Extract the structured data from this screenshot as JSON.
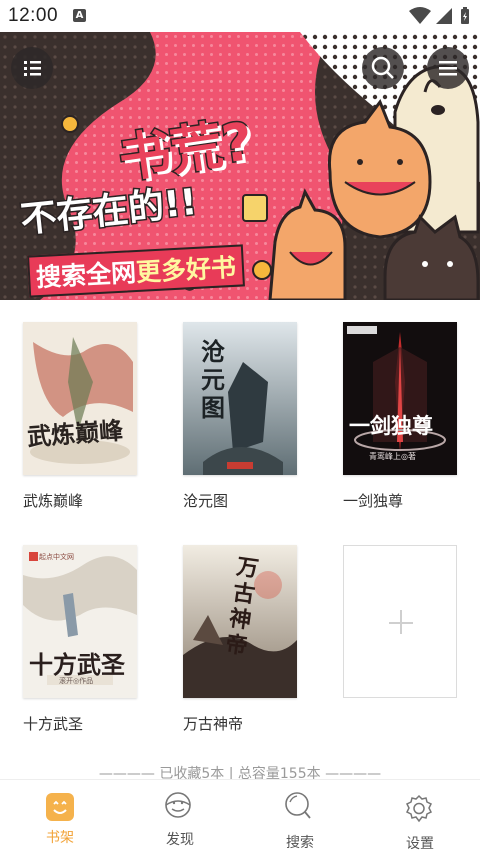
{
  "status_bar": {
    "time": "12:00",
    "notification_badge": "A",
    "icons": [
      "wifi-icon",
      "signal-icon",
      "battery-icon"
    ]
  },
  "banner": {
    "line1": "书荒?",
    "line2": "不存在的!!",
    "line3_a": "搜索全网",
    "line3_b": "更多好书",
    "accent_color": "#e9425b"
  },
  "books": [
    {
      "title": "武炼巅峰",
      "cover_text": "武炼巅峰"
    },
    {
      "title": "沧元图",
      "cover_text": "沧元图"
    },
    {
      "title": "一剑独尊",
      "cover_text": "一剑独尊",
      "cover_sub": "青鸾峰上◎著"
    },
    {
      "title": "十方武圣",
      "cover_text": "十方武圣",
      "cover_brand": "起点中文网",
      "cover_sub": "滚开◎作品"
    },
    {
      "title": "万古神帝",
      "cover_text": "万古神帝"
    }
  ],
  "summary": "———— 已收藏5本 | 总容量155本 ————",
  "bottom_nav": [
    {
      "label": "书架",
      "icon": "bookshelf-icon",
      "active": true
    },
    {
      "label": "发现",
      "icon": "discover-icon",
      "active": false
    },
    {
      "label": "搜索",
      "icon": "search-icon",
      "active": false
    },
    {
      "label": "设置",
      "icon": "settings-gear-icon",
      "active": false
    }
  ],
  "colors": {
    "active": "#f2a338",
    "inactive_text": "#555555",
    "summary_text": "#9a9a9a"
  }
}
